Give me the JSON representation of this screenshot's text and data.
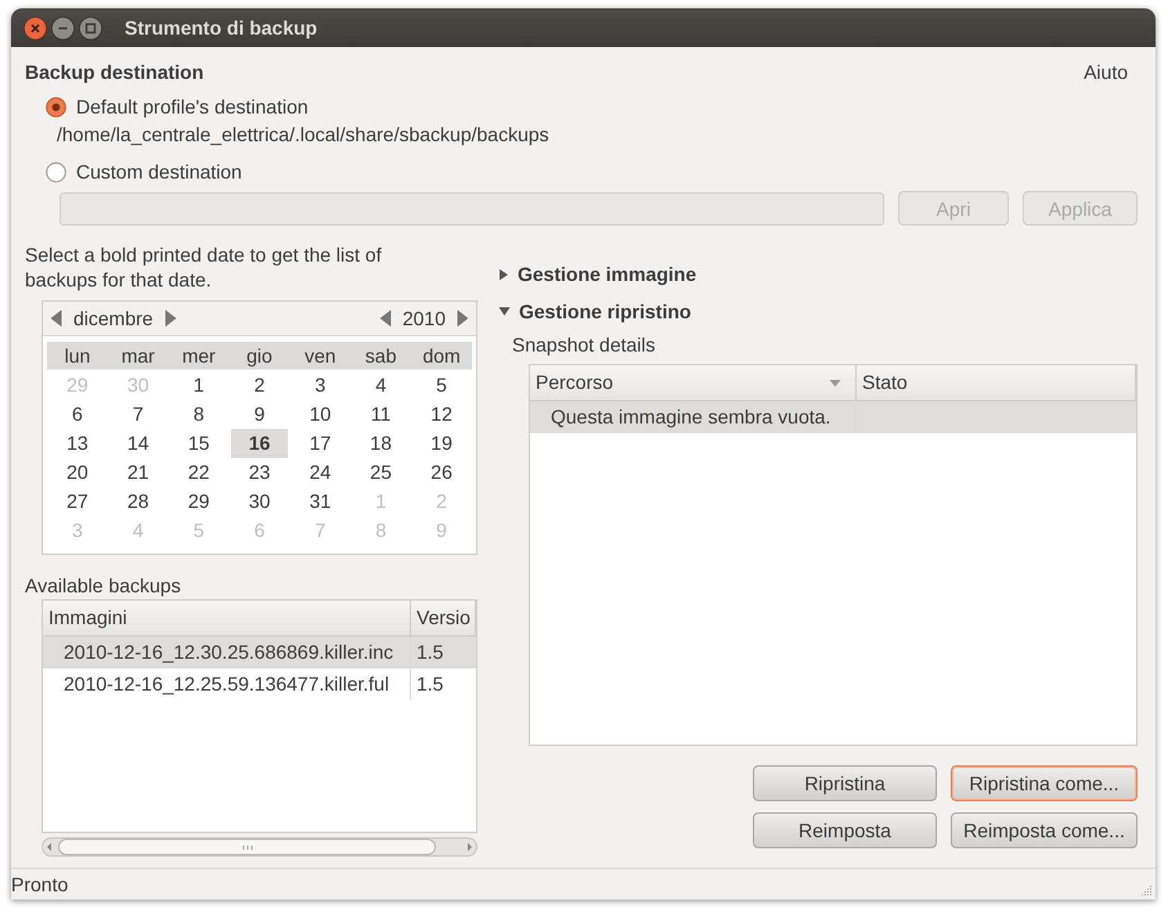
{
  "window": {
    "title": "Strumento di backup"
  },
  "help_link": "Aiuto",
  "destination": {
    "heading": "Backup destination",
    "options": [
      {
        "label": "Default profile's destination",
        "selected": true,
        "path": "/home/la_centrale_elettrica/.local/share/sbackup/backups"
      },
      {
        "label": "Custom destination",
        "selected": false
      }
    ],
    "buttons": [
      {
        "label": "Apri",
        "disabled": true
      },
      {
        "label": "Applica",
        "disabled": true
      }
    ]
  },
  "calendar_hint": "Select a bold printed date to get the list of backups for that date.",
  "calendar": {
    "month": "dicembre",
    "year": "2010",
    "weekdays": [
      "lun",
      "mar",
      "mer",
      "gio",
      "ven",
      "sab",
      "dom"
    ],
    "days": [
      {
        "day": "29",
        "other_month": true,
        "marked": false,
        "selected": false
      },
      {
        "day": "30",
        "other_month": true,
        "marked": false,
        "selected": false
      },
      {
        "day": "1",
        "other_month": false,
        "marked": false,
        "selected": false
      },
      {
        "day": "2",
        "other_month": false,
        "marked": false,
        "selected": false
      },
      {
        "day": "3",
        "other_month": false,
        "marked": false,
        "selected": false
      },
      {
        "day": "4",
        "other_month": false,
        "marked": false,
        "selected": false
      },
      {
        "day": "5",
        "other_month": false,
        "marked": false,
        "selected": false
      },
      {
        "day": "6",
        "other_month": false,
        "marked": false,
        "selected": false
      },
      {
        "day": "7",
        "other_month": false,
        "marked": false,
        "selected": false
      },
      {
        "day": "8",
        "other_month": false,
        "marked": false,
        "selected": false
      },
      {
        "day": "9",
        "other_month": false,
        "marked": false,
        "selected": false
      },
      {
        "day": "10",
        "other_month": false,
        "marked": false,
        "selected": false
      },
      {
        "day": "11",
        "other_month": false,
        "marked": false,
        "selected": false
      },
      {
        "day": "12",
        "other_month": false,
        "marked": false,
        "selected": false
      },
      {
        "day": "13",
        "other_month": false,
        "marked": false,
        "selected": false
      },
      {
        "day": "14",
        "other_month": false,
        "marked": false,
        "selected": false
      },
      {
        "day": "15",
        "other_month": false,
        "marked": false,
        "selected": false
      },
      {
        "day": "16",
        "other_month": false,
        "marked": true,
        "selected": true
      },
      {
        "day": "17",
        "other_month": false,
        "marked": false,
        "selected": false
      },
      {
        "day": "18",
        "other_month": false,
        "marked": false,
        "selected": false
      },
      {
        "day": "19",
        "other_month": false,
        "marked": false,
        "selected": false
      },
      {
        "day": "20",
        "other_month": false,
        "marked": false,
        "selected": false
      },
      {
        "day": "21",
        "other_month": false,
        "marked": false,
        "selected": false
      },
      {
        "day": "22",
        "other_month": false,
        "marked": false,
        "selected": false
      },
      {
        "day": "23",
        "other_month": false,
        "marked": false,
        "selected": false
      },
      {
        "day": "24",
        "other_month": false,
        "marked": false,
        "selected": false
      },
      {
        "day": "25",
        "other_month": false,
        "marked": false,
        "selected": false
      },
      {
        "day": "26",
        "other_month": false,
        "marked": false,
        "selected": false
      },
      {
        "day": "27",
        "other_month": false,
        "marked": false,
        "selected": false
      },
      {
        "day": "28",
        "other_month": false,
        "marked": false,
        "selected": false
      },
      {
        "day": "29",
        "other_month": false,
        "marked": false,
        "selected": false
      },
      {
        "day": "30",
        "other_month": false,
        "marked": false,
        "selected": false
      },
      {
        "day": "31",
        "other_month": false,
        "marked": false,
        "selected": false
      },
      {
        "day": "1",
        "other_month": true,
        "marked": false,
        "selected": false
      },
      {
        "day": "2",
        "other_month": true,
        "marked": false,
        "selected": false
      },
      {
        "day": "3",
        "other_month": true,
        "marked": false,
        "selected": false
      },
      {
        "day": "4",
        "other_month": true,
        "marked": false,
        "selected": false
      },
      {
        "day": "5",
        "other_month": true,
        "marked": false,
        "selected": false
      },
      {
        "day": "6",
        "other_month": true,
        "marked": false,
        "selected": false
      },
      {
        "day": "7",
        "other_month": true,
        "marked": false,
        "selected": false
      },
      {
        "day": "8",
        "other_month": true,
        "marked": false,
        "selected": false
      },
      {
        "day": "9",
        "other_month": true,
        "marked": false,
        "selected": false
      }
    ]
  },
  "backups": {
    "label": "Available backups",
    "columns": [
      "Immagini",
      "Versio"
    ],
    "rows": [
      {
        "cells": [
          "2010-12-16_12.30.25.686869.killer.inc",
          "1.5"
        ],
        "selected": true
      },
      {
        "cells": [
          "2010-12-16_12.25.59.136477.killer.ful",
          "1.5"
        ],
        "selected": false
      }
    ]
  },
  "expanders": [
    {
      "label": "Gestione immagine",
      "expanded": false
    },
    {
      "label": "Gestione ripristino",
      "expanded": true,
      "details_label": "Snapshot details",
      "columns": [
        {
          "label": "Percorso",
          "sorted": true
        },
        {
          "label": "Stato",
          "sorted": false
        }
      ],
      "rows": [
        {
          "cells": [
            "Questa immagine sembra vuota."
          ],
          "selected": true
        }
      ]
    }
  ],
  "restore_buttons": [
    {
      "label": "Ripristina",
      "focused": false
    },
    {
      "label": "Ripristina come...",
      "focused": true
    },
    {
      "label": "Reimposta",
      "focused": false
    },
    {
      "label": "Reimposta come...",
      "focused": false
    }
  ],
  "status_bar": "Pronto"
}
